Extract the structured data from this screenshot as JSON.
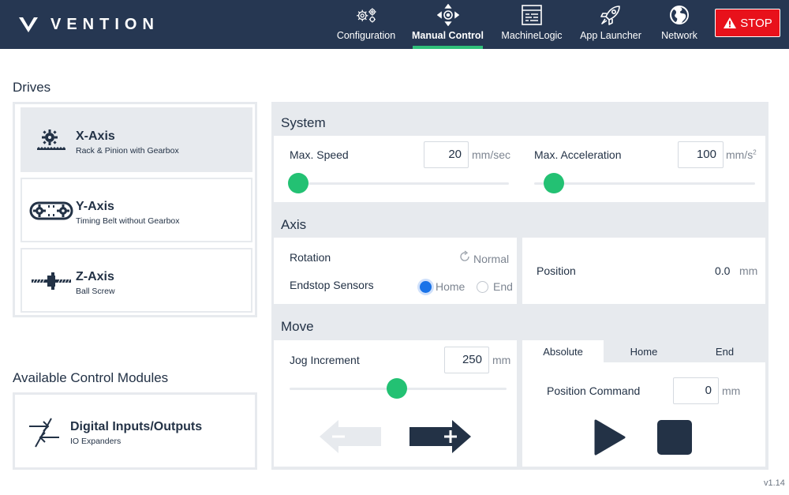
{
  "header": {
    "brand": "VENTION",
    "nav": [
      {
        "label": "Configuration",
        "icon": "gears-icon"
      },
      {
        "label": "Manual Control",
        "icon": "move-arrows-icon"
      },
      {
        "label": "MachineLogic",
        "icon": "code-window-icon"
      },
      {
        "label": "App Launcher",
        "icon": "rocket-icon"
      },
      {
        "label": "Network",
        "icon": "globe-icon"
      }
    ],
    "active_nav": "Manual Control",
    "stop_label": "STOP"
  },
  "drives": {
    "title": "Drives",
    "items": [
      {
        "name": "X-Axis",
        "sub": "Rack & Pinion with Gearbox",
        "selected": true
      },
      {
        "name": "Y-Axis",
        "sub": "Timing Belt without Gearbox",
        "selected": false
      },
      {
        "name": "Z-Axis",
        "sub": "Ball Screw",
        "selected": false
      }
    ]
  },
  "modules": {
    "title": "Available Control Modules",
    "items": [
      {
        "name": "Digital Inputs/Outputs",
        "sub": "IO Expanders"
      }
    ]
  },
  "system": {
    "title": "System",
    "max_speed_label": "Max. Speed",
    "max_speed_value": "20",
    "max_speed_unit": "mm/sec",
    "max_speed_level": 0.0,
    "max_accel_label": "Max. Acceleration",
    "max_accel_value": "100",
    "max_accel_unit": "mm/s",
    "max_accel_unit_sup": "2",
    "max_accel_level": 0.04
  },
  "axis": {
    "title": "Axis",
    "rotation_label": "Rotation",
    "rotation_value": "Normal",
    "endstop_label": "Endstop Sensors",
    "endstop_options": [
      "Home",
      "End"
    ],
    "endstop_selected": "Home",
    "position_label": "Position",
    "position_value": "0.0",
    "position_unit": "mm"
  },
  "move": {
    "title": "Move",
    "jog_label": "Jog Increment",
    "jog_value": "250",
    "jog_unit": "mm",
    "jog_level": 0.5,
    "tabs": [
      "Absolute",
      "Home",
      "End"
    ],
    "active_tab": "Absolute",
    "position_command_label": "Position Command",
    "position_command_value": "0",
    "position_command_unit": "mm"
  },
  "footer": {
    "version": "v1.14"
  },
  "colors": {
    "header_bg": "#263752",
    "accent_green": "#23c173",
    "stop_red": "#e8111b",
    "panel_bg": "#e7eaee",
    "dark_navy": "#233246",
    "radio_blue": "#1a73e8"
  }
}
